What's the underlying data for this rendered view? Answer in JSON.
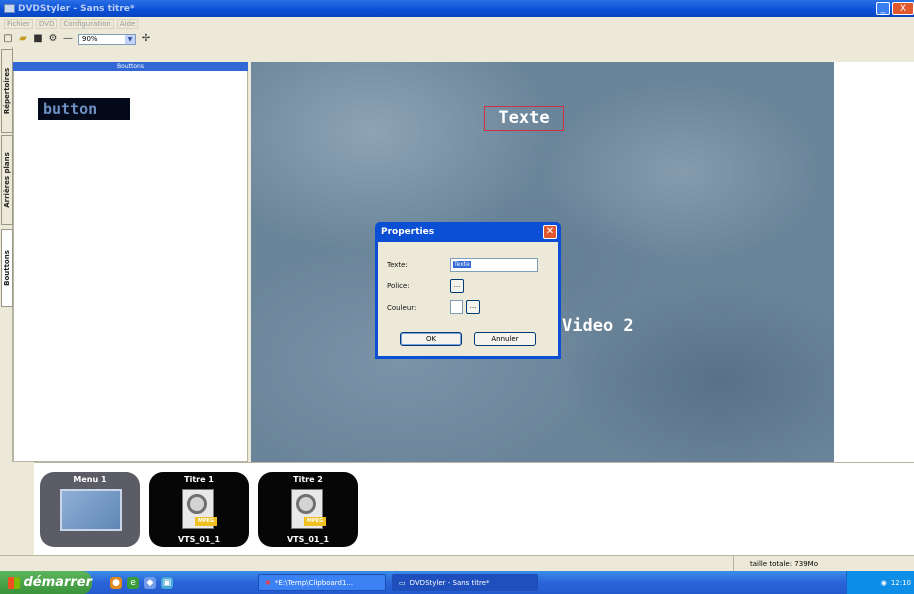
{
  "window": {
    "title": "DVDStyler - Sans titre*",
    "minimize": "_",
    "close": "X"
  },
  "menu": [
    "Fichier",
    "DVD",
    "Configuration",
    "Aide"
  ],
  "toolbar": {
    "zoom": "90%",
    "icons": [
      "new-icon",
      "open-icon",
      "save-icon",
      "settings-icon",
      "separator-icon",
      "zoom-icon"
    ]
  },
  "side_tabs": {
    "repertoires": "Répertoires",
    "arrieres_plans": "Arrières plans",
    "bouttons": "Bouttons"
  },
  "left_panel": {
    "header": "Bouttons",
    "button_preview": "button"
  },
  "canvas": {
    "texte": "Texte",
    "video2": "Video 2"
  },
  "dialog": {
    "title": "Properties",
    "texte_label": "Texte:",
    "texte_value": "Texte",
    "police_label": "Police:",
    "couleur_label": "Couleur:",
    "browse": "...",
    "ok": "OK",
    "cancel": "Annuler"
  },
  "thumbnails": [
    {
      "title": "Menu 1",
      "sub": ""
    },
    {
      "title": "Titre 1",
      "sub": "VTS_01_1"
    },
    {
      "title": "Titre 2",
      "sub": "VTS_01_1"
    }
  ],
  "mpeg_tag": "MPEG",
  "status": {
    "size": "taille totale: 739Mo"
  },
  "taskbar": {
    "start": "démarrer",
    "tasks": [
      "*E:\\Temp\\Clipboard1...",
      "DVDStyler - Sans titre*"
    ],
    "clock": "12:10"
  }
}
